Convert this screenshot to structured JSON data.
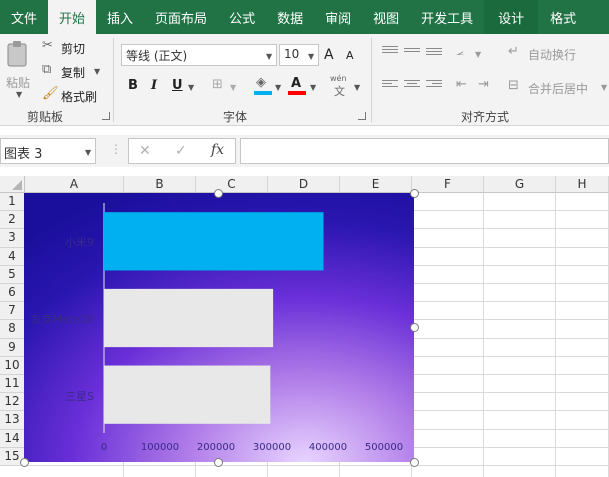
{
  "tabs": [
    "文件",
    "开始",
    "插入",
    "页面布局",
    "公式",
    "数据",
    "审阅",
    "视图",
    "开发工具",
    "设计",
    "格式"
  ],
  "active_tab": "开始",
  "clipboard": {
    "paste_label": "粘贴",
    "cut_label": "剪切",
    "copy_label": "复制",
    "format_painter_label": "格式刷",
    "group_label": "剪贴板"
  },
  "font": {
    "font_name": "等线 (正文)",
    "font_size": "10",
    "bold": "B",
    "italic": "I",
    "underline": "U",
    "grow": "A",
    "shrink": "A",
    "phonetic_top": "wén",
    "phonetic_bottom": "文",
    "group_label": "字体",
    "fill_color": "#00b0f0",
    "font_color": "#ff0000"
  },
  "alignment": {
    "wrap_text_label": "自动换行",
    "merge_center_label": "合并后居中",
    "group_label": "对齐方式"
  },
  "formula_bar": {
    "name_box": "图表 3",
    "cancel": "✕",
    "enter": "✓",
    "fx": "fx",
    "value": ""
  },
  "columns": [
    "A",
    "B",
    "C",
    "D",
    "E",
    "F",
    "G",
    "H"
  ],
  "rows": [
    "1",
    "2",
    "3",
    "4",
    "5",
    "6",
    "7",
    "8",
    "9",
    "10",
    "11",
    "12",
    "13",
    "14",
    "15"
  ],
  "chart_data": {
    "type": "bar",
    "orientation": "horizontal",
    "categories": [
      "小米9",
      "友商Mate20",
      "三星S"
    ],
    "values": [
      392000,
      302000,
      297000
    ],
    "bar_colors": [
      "#00b0f0",
      "#e8e8e8",
      "#e8e8e8"
    ],
    "x_ticks": [
      "0",
      "100000",
      "200000",
      "300000",
      "400000",
      "500000"
    ],
    "xlim": [
      0,
      500000
    ],
    "title": "",
    "xlabel": "",
    "ylabel": "",
    "legend": "none",
    "grid": false
  }
}
